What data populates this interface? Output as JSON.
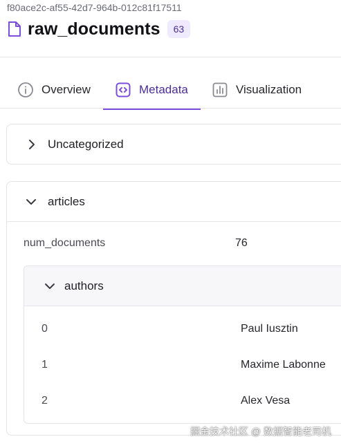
{
  "header": {
    "uuid": "f80ace2c-af55-42d7-964b-012c81f17511",
    "title": "raw_documents",
    "count": "63"
  },
  "tabs": [
    {
      "label": "Overview",
      "icon": "info-circle-icon",
      "active": false
    },
    {
      "label": "Metadata",
      "icon": "code-brackets-icon",
      "active": true
    },
    {
      "label": "Visualization",
      "icon": "bar-chart-icon",
      "active": false
    }
  ],
  "sections": {
    "uncategorized": {
      "label": "Uncategorized",
      "expanded": false
    },
    "articles": {
      "label": "articles",
      "expanded": true,
      "num_documents": {
        "key": "num_documents",
        "value": "76"
      },
      "authors": {
        "label": "authors",
        "expanded": true,
        "rows": [
          {
            "index": "0",
            "name": "Paul Iusztin"
          },
          {
            "index": "1",
            "name": "Maxime Labonne"
          },
          {
            "index": "2",
            "name": "Alex Vesa"
          }
        ]
      }
    }
  },
  "watermark": "掘金技术社区 @ 数据智能老司机",
  "colors": {
    "accent": "#7c4ddc",
    "accent_text": "#4a2d9a",
    "badge_bg": "#efeaff"
  }
}
